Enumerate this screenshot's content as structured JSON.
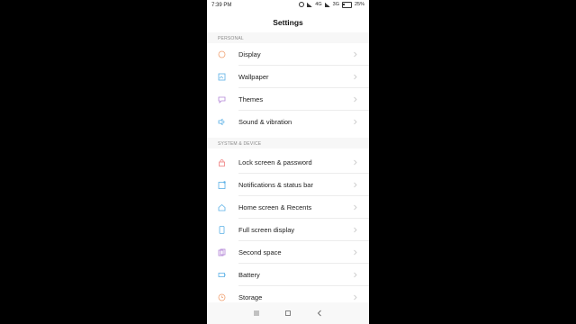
{
  "status_bar": {
    "time": "7:39 PM",
    "network1": "4G",
    "network2": "3G",
    "battery": "25%"
  },
  "header": {
    "title": "Settings"
  },
  "sections": [
    {
      "title": "PERSONAL",
      "items": [
        {
          "label": "Display",
          "icon": "display-icon",
          "color": "#f0a070"
        },
        {
          "label": "Wallpaper",
          "icon": "wallpaper-icon",
          "color": "#5ab0e6"
        },
        {
          "label": "Themes",
          "icon": "themes-icon",
          "color": "#b487d8"
        },
        {
          "label": "Sound & vibration",
          "icon": "sound-icon",
          "color": "#5ab0e6"
        }
      ]
    },
    {
      "title": "SYSTEM & DEVICE",
      "items": [
        {
          "label": "Lock screen & password",
          "icon": "lock-icon",
          "color": "#f08080"
        },
        {
          "label": "Notifications & status bar",
          "icon": "notifications-icon",
          "color": "#5ab0e6"
        },
        {
          "label": "Home screen & Recents",
          "icon": "home-icon",
          "color": "#5ab0e6"
        },
        {
          "label": "Full screen display",
          "icon": "fullscreen-icon",
          "color": "#5ab0e6"
        },
        {
          "label": "Second space",
          "icon": "second-space-icon",
          "color": "#b487d8"
        },
        {
          "label": "Battery",
          "icon": "battery-icon",
          "color": "#5ab0e6"
        },
        {
          "label": "Storage",
          "icon": "storage-icon",
          "color": "#f0a070"
        }
      ]
    }
  ],
  "nav": {
    "buttons": [
      "menu-icon",
      "home-square-icon",
      "back-icon"
    ]
  }
}
